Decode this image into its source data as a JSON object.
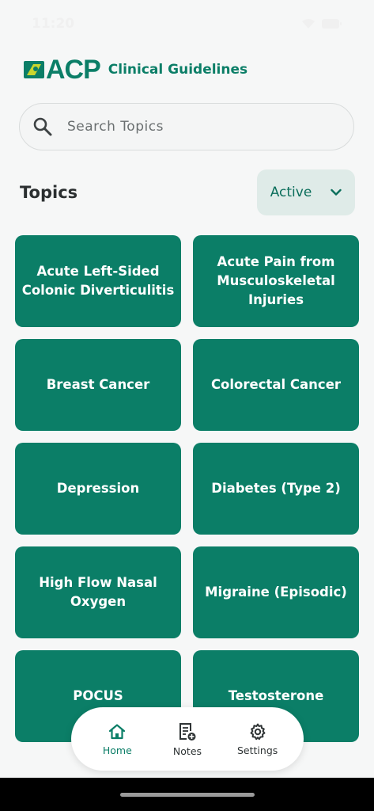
{
  "status": {
    "time": "11:20"
  },
  "brand": {
    "logo_text": "ACP",
    "subtitle": "Clinical Guidelines"
  },
  "search": {
    "placeholder": "Search Topics",
    "value": ""
  },
  "topics": {
    "title": "Topics",
    "filter_label": "Active",
    "items": [
      "Acute Left-Sided Colonic Diverticulitis",
      "Acute Pain from Musculoskeletal Injuries",
      "Breast Cancer",
      "Colorectal Cancer",
      "Depression",
      "Diabetes (Type 2)",
      "High Flow Nasal Oxygen",
      "Migraine (Episodic)",
      "POCUS",
      "Testosterone"
    ]
  },
  "nav": {
    "items": [
      {
        "label": "Home",
        "icon": "home-icon",
        "active": true
      },
      {
        "label": "Notes",
        "icon": "notes-add-icon",
        "active": false
      },
      {
        "label": "Settings",
        "icon": "gear-icon",
        "active": false
      }
    ]
  },
  "colors": {
    "brand": "#0b7e67",
    "card": "#0b7e67",
    "filter_bg": "#dfebe8",
    "background": "#f6f7f7"
  }
}
